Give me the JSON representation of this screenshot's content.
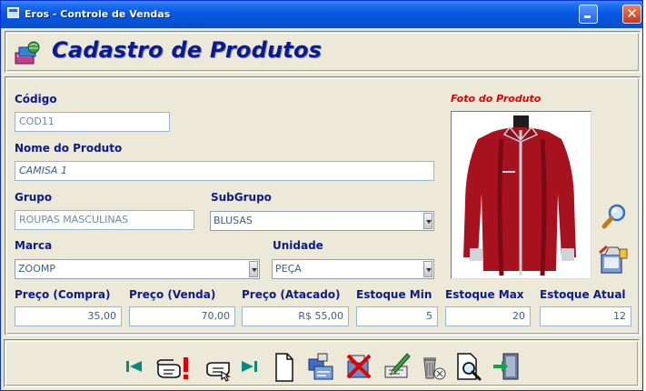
{
  "window": {
    "title": "Eros - Controle de Vendas"
  },
  "header": {
    "title": "Cadastro de Produtos"
  },
  "form": {
    "codigo": {
      "label": "Código",
      "value": "COD11"
    },
    "nome": {
      "label": "Nome do Produto",
      "value": "CAMISA 1"
    },
    "grupo": {
      "label": "Grupo",
      "value": "ROUPAS MASCULINAS"
    },
    "subgrupo": {
      "label": "SubGrupo",
      "value": "BLUSAS"
    },
    "marca": {
      "label": "Marca",
      "value": "ZOOMP"
    },
    "unidade": {
      "label": "Unidade",
      "value": "PEÇA"
    },
    "preco_compra": {
      "label": "Preço (Compra)",
      "value": "35,00"
    },
    "preco_venda": {
      "label": "Preço (Venda)",
      "value": "70,00"
    },
    "preco_atacado": {
      "label": "Preço (Atacado)",
      "value": "R$ 55,00"
    },
    "estoque_min": {
      "label": "Estoque Min",
      "value": "5"
    },
    "estoque_max": {
      "label": "Estoque Max",
      "value": "20"
    },
    "estoque_atual": {
      "label": "Estoque Atual",
      "value": "12"
    },
    "foto": {
      "label": "Foto do Produto"
    }
  },
  "toolbar": {
    "icons": [
      "first-record-icon",
      "previous-record-icon",
      "next-record-icon",
      "last-record-icon",
      "new-record-icon",
      "edit-record-icon",
      "delete-record-icon",
      "save-record-icon",
      "remove-icon",
      "preview-icon",
      "exit-icon"
    ]
  },
  "colors": {
    "label": "#0c1a8c",
    "photo_label": "#e00000",
    "title_bar": "#0553d6",
    "window_bg": "#ece9d8"
  }
}
